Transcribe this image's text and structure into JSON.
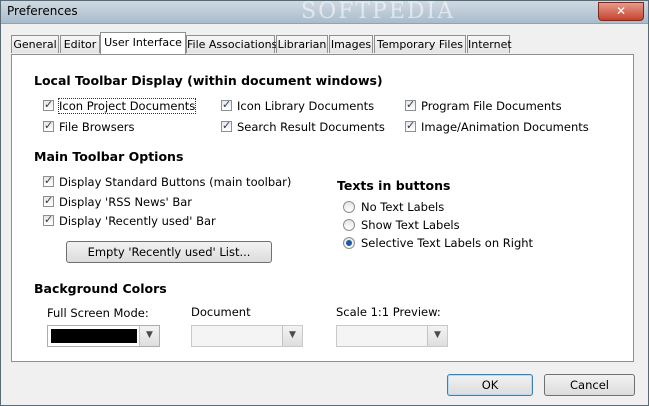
{
  "window": {
    "title": "Preferences",
    "close_label": "✕",
    "watermark": "SOFTPEDIA"
  },
  "tabs": [
    {
      "label": "General"
    },
    {
      "label": "Editor"
    },
    {
      "label": "User Interface"
    },
    {
      "label": "File Associations"
    },
    {
      "label": "Librarian"
    },
    {
      "label": "Images"
    },
    {
      "label": "Temporary Files"
    },
    {
      "label": "Internet"
    }
  ],
  "active_tab": "User Interface",
  "local_toolbar": {
    "heading": "Local Toolbar Display (within document windows)",
    "items": [
      {
        "label": "Icon Project Documents",
        "checked": true
      },
      {
        "label": "Icon Library Documents",
        "checked": true
      },
      {
        "label": "Program File Documents",
        "checked": true
      },
      {
        "label": "File Browsers",
        "checked": true
      },
      {
        "label": "Search Result Documents",
        "checked": true
      },
      {
        "label": "Image/Animation Documents",
        "checked": true
      }
    ]
  },
  "main_toolbar": {
    "heading": "Main Toolbar Options",
    "items": [
      {
        "label": "Display Standard Buttons (main toolbar)",
        "checked": true
      },
      {
        "label": "Display 'RSS News' Bar",
        "checked": true
      },
      {
        "label": "Display 'Recently used' Bar",
        "checked": true
      }
    ],
    "empty_button": "Empty 'Recently used' List..."
  },
  "texts_in_buttons": {
    "heading": "Texts in buttons",
    "options": [
      {
        "label": "No Text Labels",
        "selected": false
      },
      {
        "label": "Show Text Labels",
        "selected": false
      },
      {
        "label": "Selective Text Labels on Right",
        "selected": true
      }
    ]
  },
  "background_colors": {
    "heading": "Background Colors",
    "full_screen": {
      "label": "Full Screen Mode:",
      "color": "#000000"
    },
    "document": {
      "label": "Document",
      "enabled": false
    },
    "scale_preview": {
      "label": "Scale 1:1 Preview:",
      "enabled": false
    }
  },
  "footer": {
    "ok_label": "OK",
    "cancel_label": "Cancel"
  }
}
